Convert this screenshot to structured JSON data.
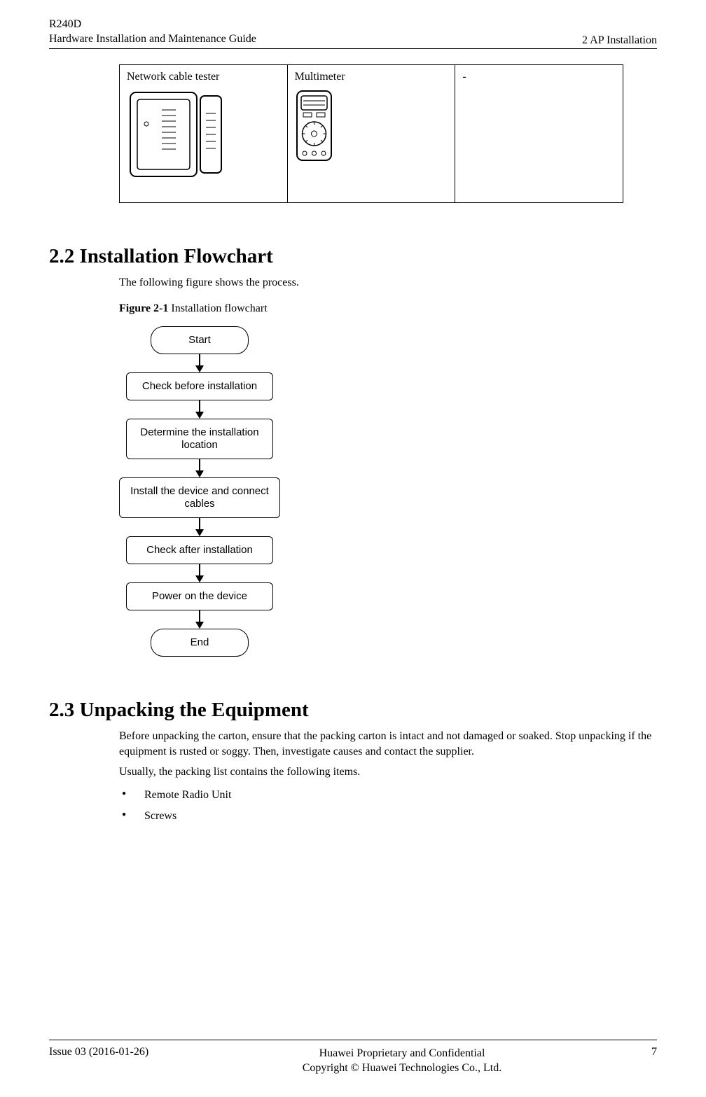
{
  "header": {
    "product": "R240D",
    "guide": "Hardware Installation and Maintenance Guide",
    "chapter": "2 AP Installation"
  },
  "tools": {
    "col1_label": "Network cable tester",
    "col2_label": "Multimeter",
    "col3_label": "-"
  },
  "section_2_2": {
    "title": "2.2 Installation Flowchart",
    "intro": "The following figure shows the process.",
    "figure_label": "Figure 2-1",
    "figure_title": "Installation flowchart",
    "nodes": {
      "start": "Start",
      "check_before": "Check before installation",
      "determine": "Determine the installation location",
      "install": "Install the device and connect cables",
      "check_after": "Check after installation",
      "power_on": "Power on the device",
      "end": "End"
    }
  },
  "section_2_3": {
    "title": "2.3 Unpacking the Equipment",
    "para1": "Before unpacking the carton, ensure that the packing carton is intact and not damaged or soaked. Stop unpacking if the equipment is rusted or soggy. Then, investigate causes and contact the supplier.",
    "para2": "Usually, the packing list contains the following items.",
    "items": [
      "Remote Radio Unit",
      "Screws"
    ]
  },
  "footer": {
    "issue": "Issue 03 (2016-01-26)",
    "line1": "Huawei Proprietary and Confidential",
    "line2": "Copyright © Huawei Technologies Co., Ltd.",
    "page": "7"
  },
  "chart_data": {
    "type": "flowchart",
    "nodes": [
      {
        "id": "start",
        "shape": "rounded",
        "label": "Start"
      },
      {
        "id": "check_before",
        "shape": "rect",
        "label": "Check before installation"
      },
      {
        "id": "determine",
        "shape": "rect",
        "label": "Determine the installation location"
      },
      {
        "id": "install",
        "shape": "rect",
        "label": "Install the device and connect cables"
      },
      {
        "id": "check_after",
        "shape": "rect",
        "label": "Check after installation"
      },
      {
        "id": "power_on",
        "shape": "rect",
        "label": "Power on the device"
      },
      {
        "id": "end",
        "shape": "rounded",
        "label": "End"
      }
    ],
    "edges": [
      [
        "start",
        "check_before"
      ],
      [
        "check_before",
        "determine"
      ],
      [
        "determine",
        "install"
      ],
      [
        "install",
        "check_after"
      ],
      [
        "check_after",
        "power_on"
      ],
      [
        "power_on",
        "end"
      ]
    ]
  }
}
